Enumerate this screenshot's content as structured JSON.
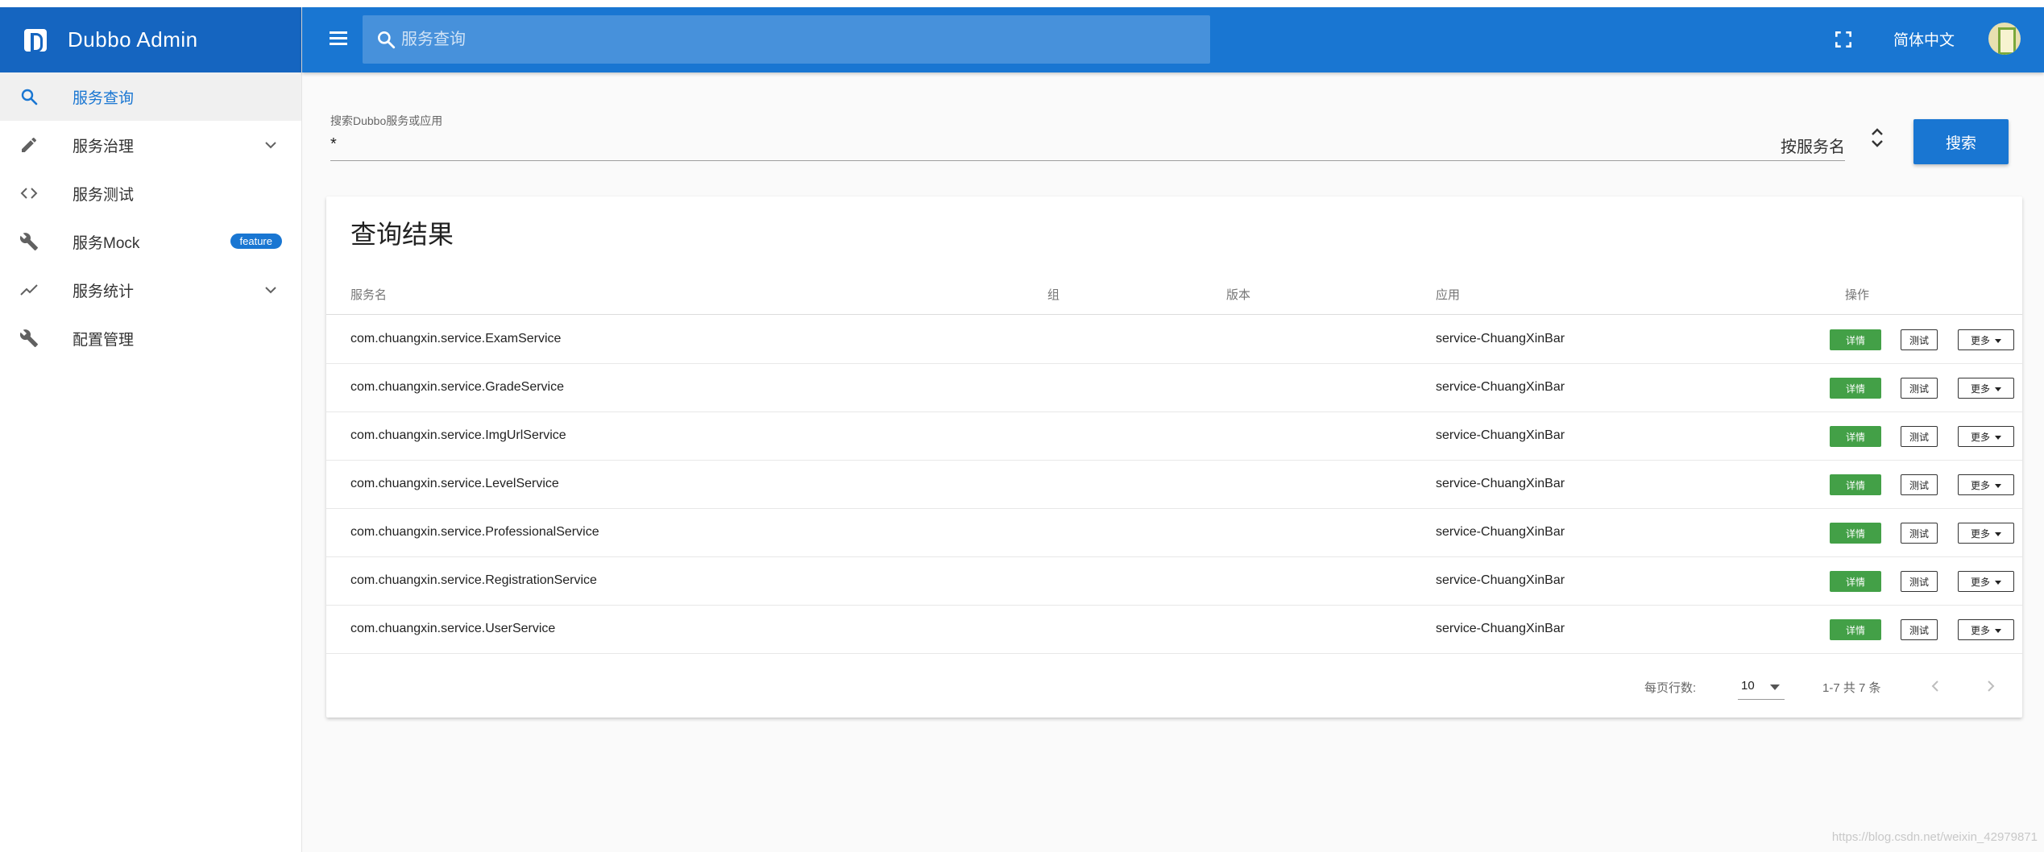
{
  "app": {
    "title": "Dubbo Admin"
  },
  "sidebar": {
    "items": [
      {
        "label": "服务查询",
        "icon": "search-icon",
        "active": true
      },
      {
        "label": "服务治理",
        "icon": "pencil-icon",
        "expandable": true
      },
      {
        "label": "服务测试",
        "icon": "code-icon"
      },
      {
        "label": "服务Mock",
        "icon": "wrench-icon",
        "badge": "feature"
      },
      {
        "label": "服务统计",
        "icon": "trending-icon",
        "expandable": true
      },
      {
        "label": "配置管理",
        "icon": "wrench-icon"
      }
    ]
  },
  "header": {
    "search_placeholder": "服务查询",
    "language": "简体中文"
  },
  "search": {
    "label": "搜索Dubbo服务或应用",
    "value": "*",
    "type": "按服务名",
    "button": "搜索"
  },
  "results": {
    "title": "查询结果",
    "columns": [
      "服务名",
      "组",
      "版本",
      "应用",
      "操作"
    ],
    "rows": [
      {
        "service": "com.chuangxin.service.ExamService",
        "group": "",
        "version": "",
        "app": "service-ChuangXinBar"
      },
      {
        "service": "com.chuangxin.service.GradeService",
        "group": "",
        "version": "",
        "app": "service-ChuangXinBar"
      },
      {
        "service": "com.chuangxin.service.ImgUrlService",
        "group": "",
        "version": "",
        "app": "service-ChuangXinBar"
      },
      {
        "service": "com.chuangxin.service.LevelService",
        "group": "",
        "version": "",
        "app": "service-ChuangXinBar"
      },
      {
        "service": "com.chuangxin.service.ProfessionalService",
        "group": "",
        "version": "",
        "app": "service-ChuangXinBar"
      },
      {
        "service": "com.chuangxin.service.RegistrationService",
        "group": "",
        "version": "",
        "app": "service-ChuangXinBar"
      },
      {
        "service": "com.chuangxin.service.UserService",
        "group": "",
        "version": "",
        "app": "service-ChuangXinBar"
      }
    ],
    "actions": {
      "detail": "详情",
      "test": "测试",
      "more": "更多"
    }
  },
  "pagination": {
    "rows_per_page_label": "每页行数:",
    "rows_per_page": "10",
    "range": "1-7 共 7 条"
  },
  "watermark": "https://blog.csdn.net/weixin_42979871",
  "colors": {
    "primary": "#1976d2",
    "brand": "#1565c0",
    "success": "#43a047"
  }
}
